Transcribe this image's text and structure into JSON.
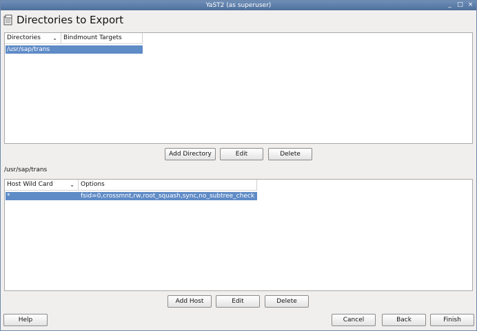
{
  "window": {
    "title": "YaST2 (as superuser)",
    "controls": [
      "_",
      "□",
      "×"
    ]
  },
  "page": {
    "title": "Directories to Export"
  },
  "directories_table": {
    "columns": [
      "Directories",
      "Bindmount Targets"
    ],
    "rows": [
      {
        "directory": "/usr/sap/trans",
        "target": ""
      }
    ]
  },
  "directory_buttons": {
    "add": "Add Directory",
    "edit": "Edit",
    "delete": "Delete"
  },
  "selected_directory": "/usr/sap/trans",
  "hosts_table": {
    "columns": [
      "Host Wild Card",
      "Options"
    ],
    "rows": [
      {
        "host": "*",
        "options": "fsid=0,crossmnt,rw,root_squash,sync,no_subtree_check"
      }
    ]
  },
  "host_buttons": {
    "add": "Add Host",
    "edit": "Edit",
    "delete": "Delete"
  },
  "footer": {
    "help": "Help",
    "cancel": "Cancel",
    "back": "Back",
    "finish": "Finish"
  },
  "colors": {
    "selection": "#5f8bc6",
    "titlebar": "#5a7ca8"
  },
  "icons": {
    "heading": "directory-icon",
    "sort": "chevron-down-icon"
  }
}
